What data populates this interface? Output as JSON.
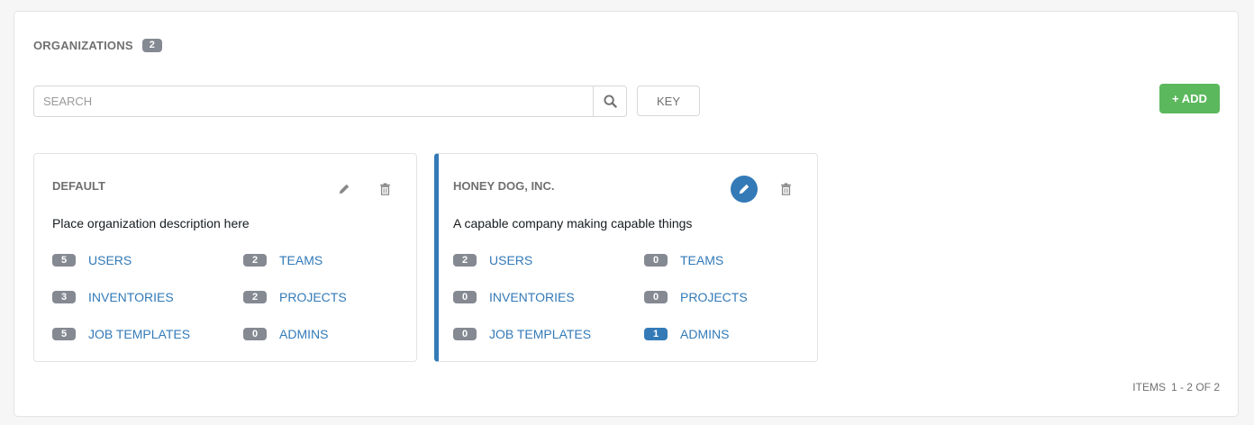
{
  "header": {
    "title": "ORGANIZATIONS",
    "count": "2"
  },
  "search": {
    "placeholder": "SEARCH",
    "value": ""
  },
  "toolbar": {
    "key_label": "KEY",
    "add_label": "+ ADD",
    "add_color": "#5cb85c"
  },
  "organizations": [
    {
      "name": "DEFAULT",
      "description": "Place organization description here",
      "selected": false,
      "links": [
        {
          "count": "5",
          "label": "USERS"
        },
        {
          "count": "2",
          "label": "TEAMS"
        },
        {
          "count": "3",
          "label": "INVENTORIES"
        },
        {
          "count": "2",
          "label": "PROJECTS"
        },
        {
          "count": "5",
          "label": "JOB TEMPLATES"
        },
        {
          "count": "0",
          "label": "ADMINS"
        }
      ]
    },
    {
      "name": "HONEY DOG, INC.",
      "description": "A capable company making capable things",
      "selected": true,
      "links": [
        {
          "count": "2",
          "label": "USERS"
        },
        {
          "count": "0",
          "label": "TEAMS"
        },
        {
          "count": "0",
          "label": "INVENTORIES"
        },
        {
          "count": "0",
          "label": "PROJECTS"
        },
        {
          "count": "0",
          "label": "JOB TEMPLATES"
        },
        {
          "count": "1",
          "label": "ADMINS",
          "highlight": true
        }
      ]
    }
  ],
  "pagination": {
    "label": "ITEMS",
    "range": "1 - 2 OF 2"
  },
  "colors": {
    "link": "#337ab7",
    "badge": "#848992",
    "selected_border": "#337ab7"
  }
}
